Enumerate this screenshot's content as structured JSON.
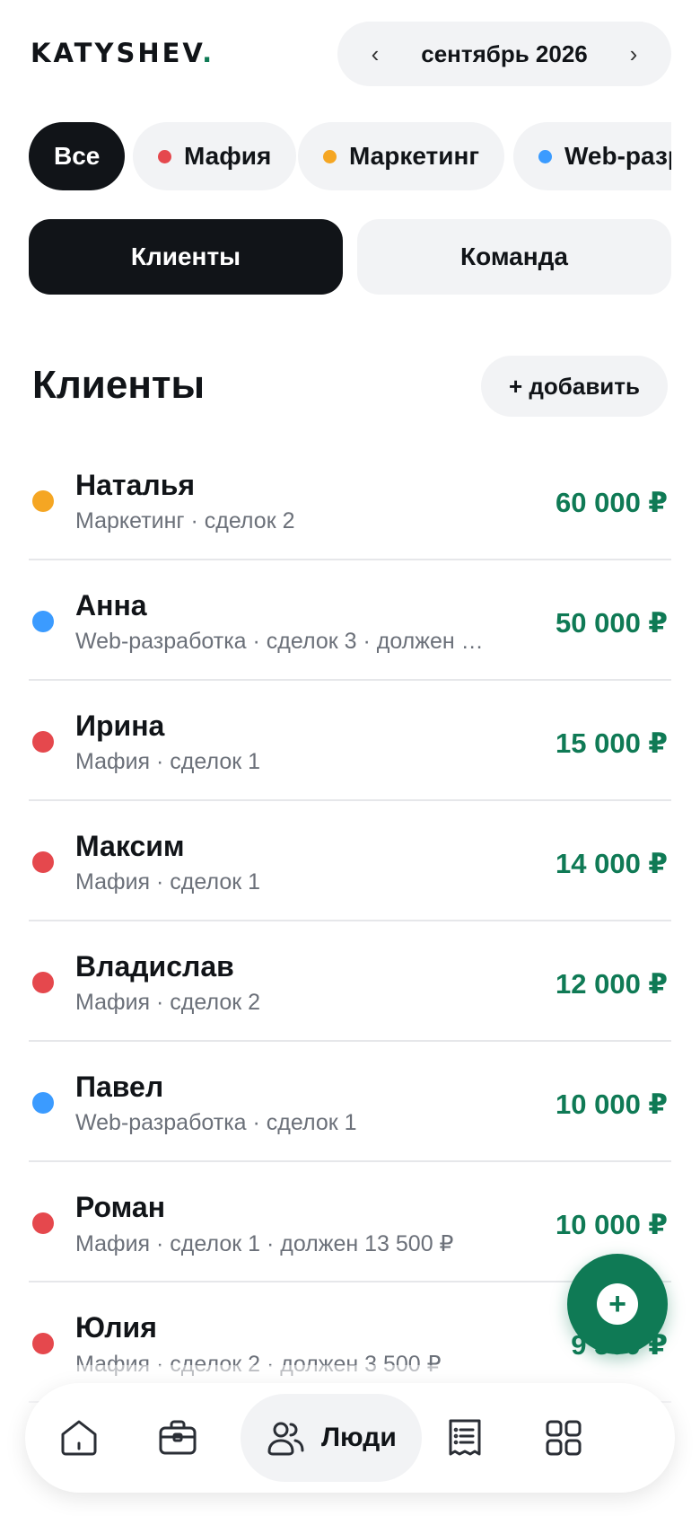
{
  "header": {
    "logo_text": "KATYSHEV",
    "logo_dot": ".",
    "month_label": "сентябрь 2026",
    "prev_arrow": "‹",
    "next_arrow": "›"
  },
  "filters": [
    {
      "label": "Все",
      "active": true
    },
    {
      "label": "Мафия",
      "color": "#e5484d"
    },
    {
      "label": "Маркетинг",
      "color": "#f5a623"
    },
    {
      "label": "Web-разработка",
      "color": "#3b9bff"
    }
  ],
  "segments": {
    "clients_label": "Клиенты",
    "team_label": "Команда",
    "active": "clients"
  },
  "section": {
    "title": "Клиенты",
    "add_label": "+ добавить"
  },
  "clients": [
    {
      "name": "Наталья",
      "meta": "Маркетинг · сделок 2",
      "amount": "60 000 ₽",
      "color": "#f5a623"
    },
    {
      "name": "Анна",
      "meta": "Web-разработка · сделок 3 · должен …",
      "amount": "50 000 ₽",
      "color": "#3b9bff"
    },
    {
      "name": "Ирина",
      "meta": "Мафия · сделок 1",
      "amount": "15 000 ₽",
      "color": "#e5484d"
    },
    {
      "name": "Максим",
      "meta": "Мафия · сделок 1",
      "amount": "14 000 ₽",
      "color": "#e5484d"
    },
    {
      "name": "Владислав",
      "meta": "Мафия · сделок 2",
      "amount": "12 000 ₽",
      "color": "#e5484d"
    },
    {
      "name": "Павел",
      "meta": "Web-разработка · сделок 1",
      "amount": "10 000 ₽",
      "color": "#3b9bff"
    },
    {
      "name": "Роман",
      "meta": "Мафия · сделок 1 · должен 13 500 ₽",
      "amount": "10 000 ₽",
      "color": "#e5484d"
    },
    {
      "name": "Юлия",
      "meta": "Мафия · сделок 2 · должен 3 500 ₽",
      "amount": "9 500 ₽",
      "color": "#e5484d"
    }
  ],
  "fab": {
    "icon": "plus-icon",
    "symbol": "+"
  },
  "tabbar": {
    "active_label": "Люди",
    "tabs": [
      "home-icon",
      "briefcase-icon",
      "people-icon",
      "receipt-icon",
      "grid-icon"
    ]
  },
  "colors": {
    "accent": "#0f7a55",
    "dark": "#111418",
    "pill_bg": "#f2f3f5",
    "muted_text": "#6b7079"
  }
}
